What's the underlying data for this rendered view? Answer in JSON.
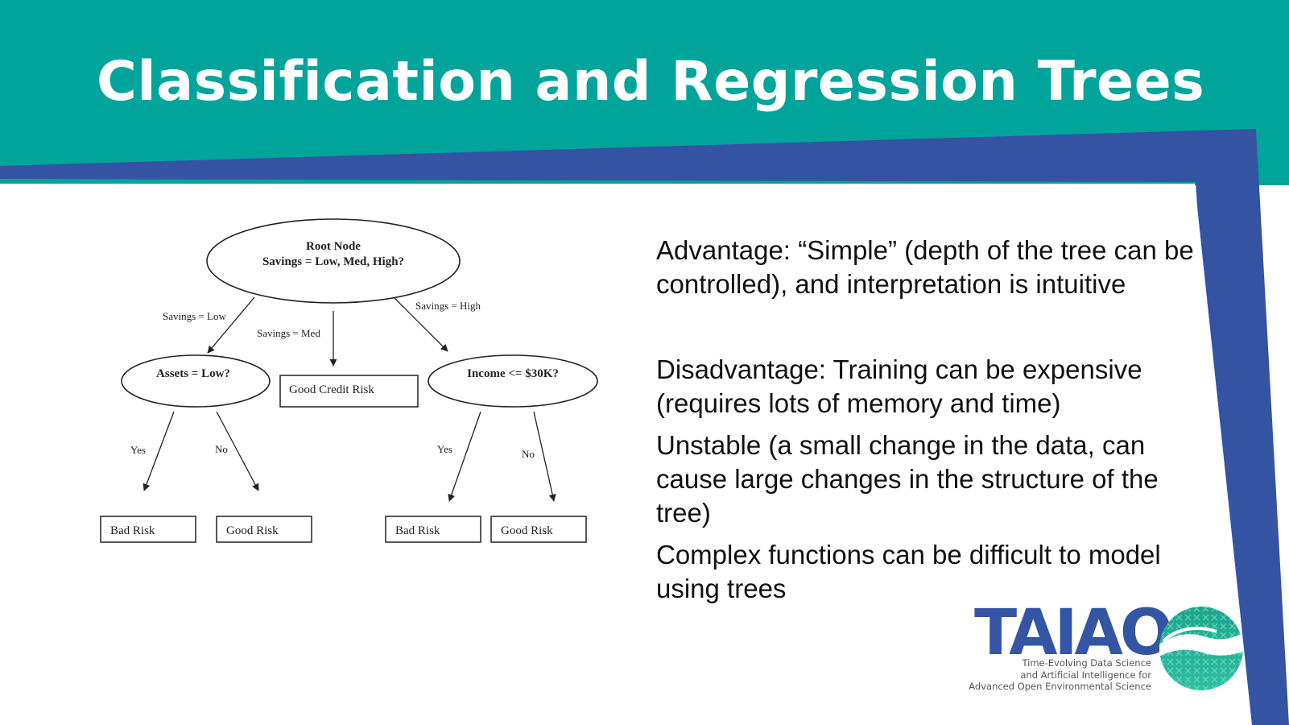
{
  "slide": {
    "title": "Classification and Regression Trees",
    "colors": {
      "header_teal": "#00a49a",
      "band_blue": "#3453a3",
      "shadow_gray": "#9a9a9a",
      "text": "#111111"
    }
  },
  "diagram": {
    "root": {
      "line1": "Root Node",
      "line2": "Savings = Low, Med, High?"
    },
    "edge_labels": {
      "savings_low": "Savings = Low",
      "savings_med": "Savings = Med",
      "savings_high": "Savings = High",
      "assets_yes": "Yes",
      "assets_no": "No",
      "income_yes": "Yes",
      "income_no": "No"
    },
    "nodes": {
      "assets": "Assets = Low?",
      "good_credit": "Good Credit Risk",
      "income": "Income <= $30K?"
    },
    "leaves": {
      "assets_yes": "Bad Risk",
      "assets_no": "Good Risk",
      "income_yes": "Bad Risk",
      "income_no": "Good Risk"
    }
  },
  "bullets": [
    "Advantage: “Simple” (depth of the tree can be controlled), and interpretation is intuitive",
    "Disadvantage: Training can be expensive (requires lots of memory and time)",
    "Unstable (a small change in the data, can cause large changes in the structure of the tree)",
    "Complex functions can be difficult to model using trees"
  ],
  "logo": {
    "wordmark": "TAIAO",
    "tagline": [
      "Time-Evolving Data Science",
      "and Artificial Intelligence for",
      "Advanced Open Environmental Science"
    ],
    "icon": "globe-wave-icon"
  }
}
